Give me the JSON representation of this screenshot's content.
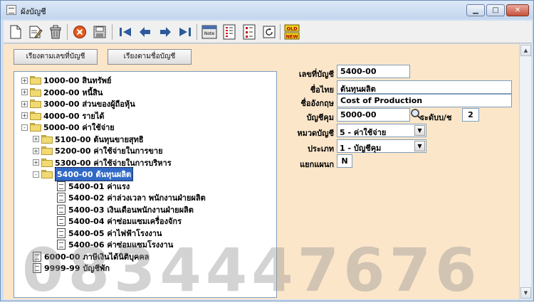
{
  "window": {
    "title": "ผังบัญชี"
  },
  "toolbar": {
    "icons": [
      "new-doc-icon",
      "edit-doc-icon",
      "trash-icon",
      "cancel-icon",
      "save-icon",
      "first-icon",
      "prev-icon",
      "next-icon",
      "last-icon",
      "note-icon",
      "report-icon",
      "report2-icon",
      "refresh-icon",
      "old-new-icon"
    ],
    "note_label": "Note",
    "old_label": "OLD",
    "new_label": "NEW"
  },
  "buttons": {
    "sort_by_code": "เรียงตามเลขที่บัญชี",
    "sort_by_name": "เรียงตามชื่อบัญชี"
  },
  "tree": [
    {
      "label": "1000-00 สินทรัพย์",
      "type": "folder",
      "expander": "+"
    },
    {
      "label": "2000-00 หนี้สิน",
      "type": "folder",
      "expander": "+"
    },
    {
      "label": "3000-00 ส่วนของผู้ถือหุ้น",
      "type": "folder",
      "expander": "+"
    },
    {
      "label": "4000-00 รายได้",
      "type": "folder",
      "expander": "+"
    },
    {
      "label": "5000-00 ค่าใช้จ่าย",
      "type": "folder",
      "expander": "-"
    },
    {
      "label": "5100-00 ต้นทุนขายสุทธิ",
      "type": "folder",
      "expander": "+"
    },
    {
      "label": "5200-00 ค่าใช้จ่ายในการขาย",
      "type": "folder",
      "expander": "+"
    },
    {
      "label": "5300-00 ค่าใช้จ่ายในการบริหาร",
      "type": "folder",
      "expander": "+"
    },
    {
      "label": "5400-00 ต้นทุนผลิต",
      "type": "folder",
      "expander": "-",
      "selected": true
    },
    {
      "label": "5400-01 ค่าแรง",
      "type": "doc"
    },
    {
      "label": "5400-02 ค่าล่วงเวลา พนักงานฝ่ายผลิต",
      "type": "doc"
    },
    {
      "label": "5400-03 เงินเดือนพนักงานฝ่ายผลิต",
      "type": "doc"
    },
    {
      "label": "5400-04 ค่าซ่อมแซมเครื่องจักร",
      "type": "doc"
    },
    {
      "label": "5400-05 ค่าไฟฟ้าโรงงาน",
      "type": "doc"
    },
    {
      "label": "5400-06 ค่าซ่อมแซมโรงงาน",
      "type": "doc"
    },
    {
      "label": "6000-00 ภาษีเงินได้นิติบุคคล",
      "type": "doc"
    },
    {
      "label": "9999-99 บัญชีพัก",
      "type": "doc"
    }
  ],
  "form": {
    "account_no_label": "เลขที่บัญชี",
    "account_no": "5400-00",
    "thai_name_label": "ชื่อไทย",
    "thai_name": "ต้นทุนผลิต",
    "eng_name_label": "ชื่ออังกฤษ",
    "eng_name": "Cost of Production",
    "control_account_label": "บัญชีคุม",
    "control_account": "5000-00",
    "level_label": "ระดับบ/ช",
    "level": "2",
    "category_label": "หมวดบัญชี",
    "category": "5 - ค่าใช้จ่าย",
    "type_label": "ประเภท",
    "type": "1 - บัญชีคุม",
    "split_dept_label": "แยกแผนก",
    "split_dept": "N"
  },
  "watermark": "0834447676",
  "colors": {
    "panel_bg": "#fbe6c9",
    "selection": "#3169c6",
    "title_bar": "#cfe0f4"
  }
}
